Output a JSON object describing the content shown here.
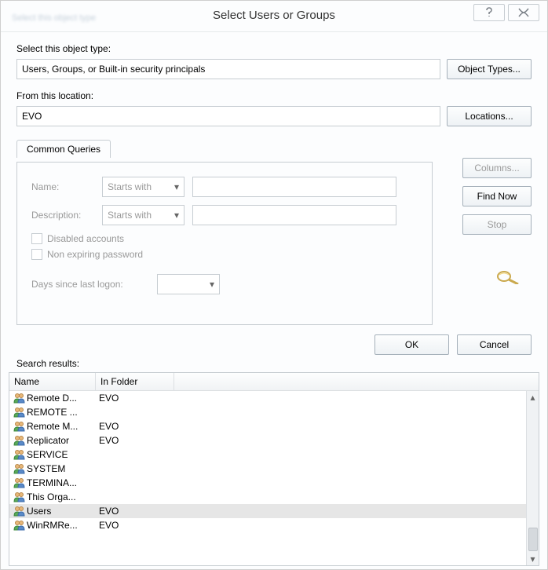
{
  "title": "Select Users or Groups",
  "objectType": {
    "label": "Select this object type:",
    "value": "Users, Groups, or Built-in security principals",
    "button": "Object Types..."
  },
  "location": {
    "label": "From this location:",
    "value": "EVO",
    "button": "Locations..."
  },
  "tab": {
    "label": "Common Queries"
  },
  "queries": {
    "name_label": "Name:",
    "desc_label": "Description:",
    "match_mode": "Starts with",
    "name_value": "",
    "desc_value": "",
    "disabled_cb": "Disabled accounts",
    "nonexp_cb": "Non expiring password",
    "days_label": "Days since last logon:"
  },
  "side": {
    "columns": "Columns...",
    "find": "Find Now",
    "stop": "Stop"
  },
  "ok": "OK",
  "cancel": "Cancel",
  "results_label": "Search results:",
  "table": {
    "headers": [
      "Name",
      "In Folder"
    ]
  },
  "results": [
    {
      "name": "Remote D...",
      "folder": "EVO",
      "selected": false
    },
    {
      "name": "REMOTE ...",
      "folder": "",
      "selected": false
    },
    {
      "name": "Remote M...",
      "folder": "EVO",
      "selected": false
    },
    {
      "name": "Replicator",
      "folder": "EVO",
      "selected": false
    },
    {
      "name": "SERVICE",
      "folder": "",
      "selected": false
    },
    {
      "name": "SYSTEM",
      "folder": "",
      "selected": false
    },
    {
      "name": "TERMINA...",
      "folder": "",
      "selected": false
    },
    {
      "name": "This Orga...",
      "folder": "",
      "selected": false
    },
    {
      "name": "Users",
      "folder": "EVO",
      "selected": true
    },
    {
      "name": "WinRMRe...",
      "folder": "EVO",
      "selected": false
    }
  ]
}
